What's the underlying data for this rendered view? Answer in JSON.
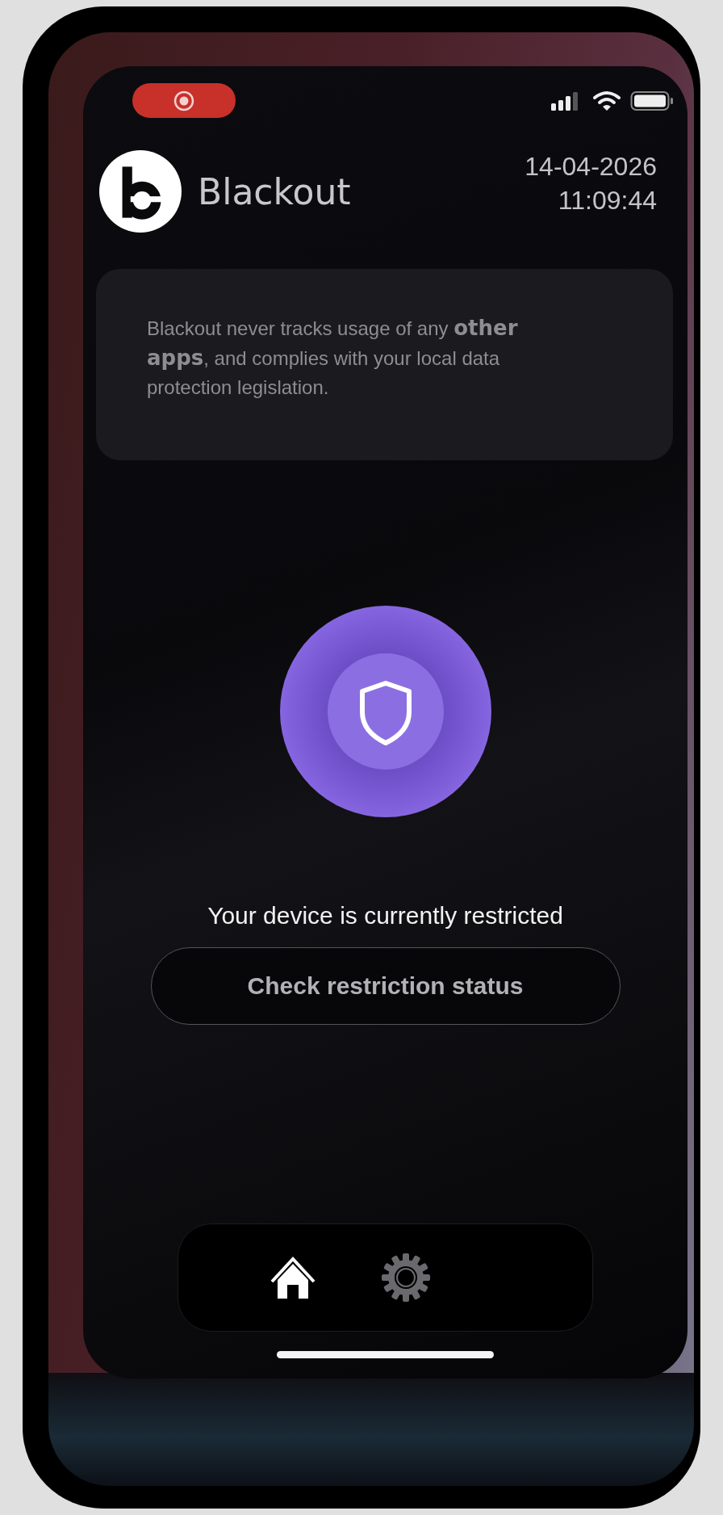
{
  "app": {
    "name": "Blackout"
  },
  "date": "14-04-2026",
  "time": "11:09:44",
  "notice": "Blackout never tracks usage of any **other apps**, and complies with your local data protection legislation.",
  "status": "Your device is currently restricted",
  "check_button": "Check restriction status",
  "nav": [
    {
      "kind": "home",
      "selected": true
    },
    {
      "kind": "settings",
      "selected": false
    }
  ]
}
